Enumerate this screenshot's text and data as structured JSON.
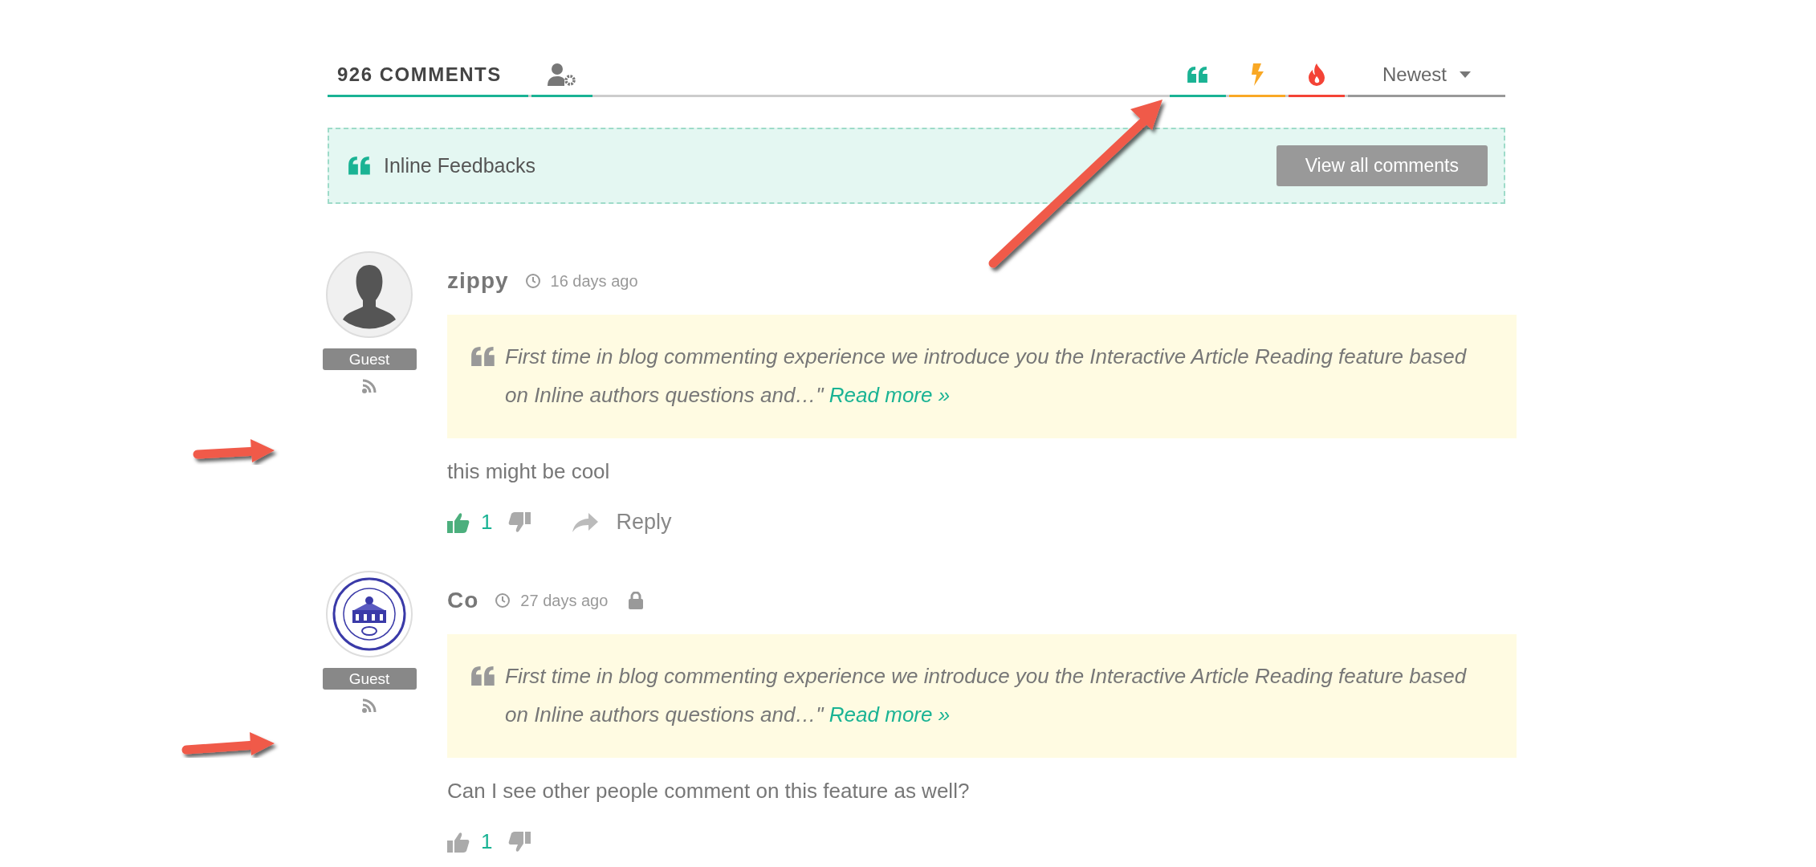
{
  "header": {
    "count_label": "926 COMMENTS",
    "sort_tabs": [
      {
        "kind": "quote",
        "color": "#1ab394"
      },
      {
        "kind": "bolt",
        "color": "#f9a825"
      },
      {
        "kind": "flame",
        "color": "#f44336"
      }
    ],
    "sort_dropdown": {
      "value": "Newest"
    }
  },
  "feedback_bar": {
    "label": "Inline Feedbacks",
    "button": "View all comments"
  },
  "comments": [
    {
      "avatar": {
        "kind": "silhouette"
      },
      "author": "zippy",
      "time": "16 days ago",
      "locked": false,
      "badge": "Guest",
      "quote": "First time in blog commenting experience we introduce you the Interactive Article Reading feature based on Inline authors questions and…\"",
      "read_more": "Read more »",
      "text": "this might be cool",
      "liked": true,
      "votes": "1",
      "reply": "Reply"
    },
    {
      "avatar": {
        "kind": "seal"
      },
      "author": "Co",
      "time": "27 days ago",
      "locked": true,
      "badge": "Guest",
      "quote": "First time in blog commenting experience we introduce you the Interactive Article Reading feature based on Inline authors questions and…\"",
      "read_more": "Read more »",
      "text": "Can I see other people comment on this feature as well?",
      "liked": false,
      "votes": "1"
    }
  ]
}
